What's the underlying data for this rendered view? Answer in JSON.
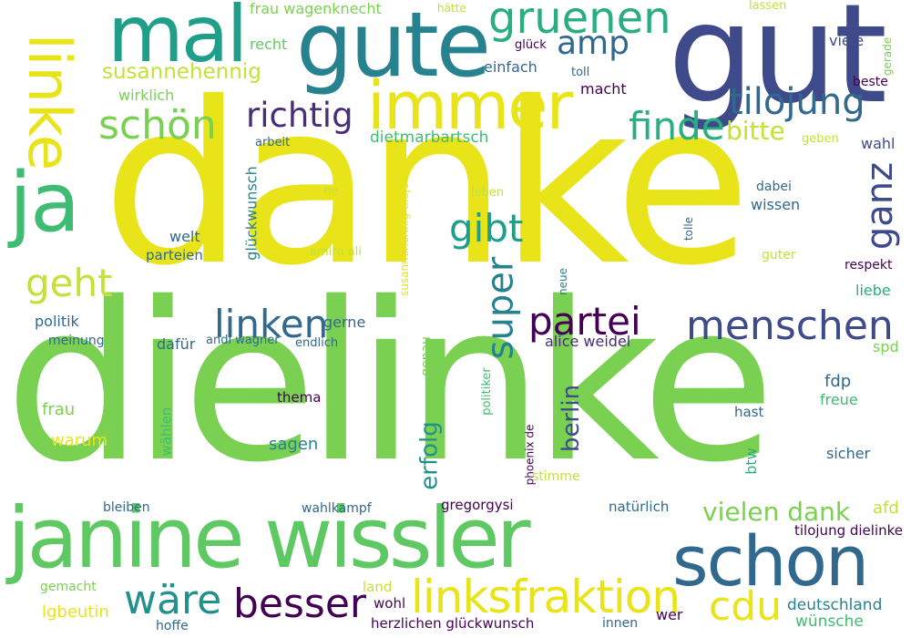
{
  "palette": {
    "yellow": "#e8e419",
    "light_green": "#7ad151",
    "green": "#5ec962",
    "green2": "#3fbc73",
    "teal_green": "#28ae80",
    "teal": "#1f9e89",
    "teal2": "#21918c",
    "blue_teal": "#26828e",
    "blue": "#31688e",
    "dark_blue": "#3e4a89",
    "indigo": "#472d7b",
    "purple": "#440154"
  },
  "words": [
    {
      "id": "danke",
      "text": "danke"
    },
    {
      "id": "dielinke",
      "text": "dielinke"
    },
    {
      "id": "janine-wissler",
      "text": "janine wissler"
    },
    {
      "id": "gut",
      "text": "gut"
    },
    {
      "id": "gute",
      "text": "gute"
    },
    {
      "id": "mal",
      "text": "mal"
    },
    {
      "id": "linke",
      "text": "linke"
    },
    {
      "id": "ja",
      "text": "ja"
    },
    {
      "id": "schon",
      "text": "schon"
    },
    {
      "id": "immer",
      "text": "immer"
    },
    {
      "id": "gruenen",
      "text": "gruenen"
    },
    {
      "id": "amp",
      "text": "amp"
    },
    {
      "id": "linksfraktion",
      "text": "linksfraktion"
    },
    {
      "id": "menschen",
      "text": "menschen"
    },
    {
      "id": "partei",
      "text": "partei"
    },
    {
      "id": "linken",
      "text": "linken"
    },
    {
      "id": "besser",
      "text": "besser"
    },
    {
      "id": "waere",
      "text": "wäre"
    },
    {
      "id": "cdu",
      "text": "cdu"
    },
    {
      "id": "schoen",
      "text": "schön"
    },
    {
      "id": "richtig",
      "text": "richtig"
    },
    {
      "id": "finde",
      "text": "finde"
    },
    {
      "id": "tilojung",
      "text": "tilojung"
    },
    {
      "id": "geht",
      "text": "geht"
    },
    {
      "id": "gibt",
      "text": "gibt"
    },
    {
      "id": "super",
      "text": "super"
    },
    {
      "id": "ganz",
      "text": "ganz"
    },
    {
      "id": "vielen-dank",
      "text": "vielen dank"
    },
    {
      "id": "susannehennig",
      "text": "susannehennig"
    },
    {
      "id": "bitte",
      "text": "bitte"
    },
    {
      "id": "erfolg",
      "text": "erfolg"
    },
    {
      "id": "berlin",
      "text": "berlin"
    },
    {
      "id": "dietmarbartsch",
      "text": "dietmarbartsch"
    },
    {
      "id": "deutschland",
      "text": "deutschland"
    },
    {
      "id": "wuensche",
      "text": "wünsche"
    },
    {
      "id": "frau-wagenknecht",
      "text": "frau wagenknecht"
    },
    {
      "id": "recht",
      "text": "recht"
    },
    {
      "id": "einfach",
      "text": "einfach"
    },
    {
      "id": "glueck",
      "text": "glück"
    },
    {
      "id": "toll",
      "text": "toll"
    },
    {
      "id": "macht",
      "text": "macht"
    },
    {
      "id": "wirklich",
      "text": "wirklich"
    },
    {
      "id": "haette",
      "text": "hätte"
    },
    {
      "id": "lassen",
      "text": "lassen"
    },
    {
      "id": "viele",
      "text": "viele"
    },
    {
      "id": "gerade",
      "text": "gerade"
    },
    {
      "id": "beste",
      "text": "beste"
    },
    {
      "id": "arbeit",
      "text": "arbeit"
    },
    {
      "id": "wahl",
      "text": "wahl"
    },
    {
      "id": "geben",
      "text": "geben"
    },
    {
      "id": "glueckwunsch",
      "text": "glückwunsch"
    },
    {
      "id": "susannehennig-tilojung",
      "text": "susannehennig tilojung"
    },
    {
      "id": "ne",
      "text": "ne"
    },
    {
      "id": "leben",
      "text": "leben"
    },
    {
      "id": "dabei",
      "text": "dabei"
    },
    {
      "id": "wissen",
      "text": "wissen"
    },
    {
      "id": "welt",
      "text": "welt"
    },
    {
      "id": "parteien",
      "text": "parteien"
    },
    {
      "id": "amira-ali",
      "text": "amira ali"
    },
    {
      "id": "tolle",
      "text": "tolle"
    },
    {
      "id": "guter",
      "text": "guter"
    },
    {
      "id": "respekt",
      "text": "respekt"
    },
    {
      "id": "neue",
      "text": "neue"
    },
    {
      "id": "liebe",
      "text": "liebe"
    },
    {
      "id": "politik",
      "text": "politik"
    },
    {
      "id": "gerne",
      "text": "gerne"
    },
    {
      "id": "meinung",
      "text": "meinung"
    },
    {
      "id": "dafuer",
      "text": "dafür"
    },
    {
      "id": "andi-wagner",
      "text": "andi wagner"
    },
    {
      "id": "endlich",
      "text": "endlich"
    },
    {
      "id": "alice-weidel",
      "text": "alice weidel"
    },
    {
      "id": "spd",
      "text": "spd"
    },
    {
      "id": "genau",
      "text": "genau"
    },
    {
      "id": "fdp",
      "text": "fdp"
    },
    {
      "id": "freue",
      "text": "freue"
    },
    {
      "id": "frau",
      "text": "frau"
    },
    {
      "id": "thema",
      "text": "thema"
    },
    {
      "id": "politiker",
      "text": "politiker"
    },
    {
      "id": "hast",
      "text": "hast"
    },
    {
      "id": "waehlen",
      "text": "wählen"
    },
    {
      "id": "warum",
      "text": "warum"
    },
    {
      "id": "sagen",
      "text": "sagen"
    },
    {
      "id": "phoenix-de",
      "text": "phoenix de"
    },
    {
      "id": "sicher",
      "text": "sicher"
    },
    {
      "id": "btw",
      "text": "btw"
    },
    {
      "id": "stimme",
      "text": "stimme"
    },
    {
      "id": "bleiben",
      "text": "bleiben"
    },
    {
      "id": "wahlkampf",
      "text": "wahlkampf"
    },
    {
      "id": "gregorgysi",
      "text": "gregorgysi"
    },
    {
      "id": "natuerlich",
      "text": "natürlich"
    },
    {
      "id": "afd",
      "text": "afd"
    },
    {
      "id": "tilojung-dielinke",
      "text": "tilojung dielinke"
    },
    {
      "id": "gemacht",
      "text": "gemacht"
    },
    {
      "id": "land",
      "text": "land"
    },
    {
      "id": "wohl",
      "text": "wohl"
    },
    {
      "id": "lgbeutin",
      "text": "lgbeutin"
    },
    {
      "id": "hoffe",
      "text": "hoffe"
    },
    {
      "id": "herzlichen-glueckwunsch",
      "text": "herzlichen glückwunsch"
    },
    {
      "id": "wer",
      "text": "wer"
    },
    {
      "id": "innen",
      "text": "innen"
    }
  ]
}
